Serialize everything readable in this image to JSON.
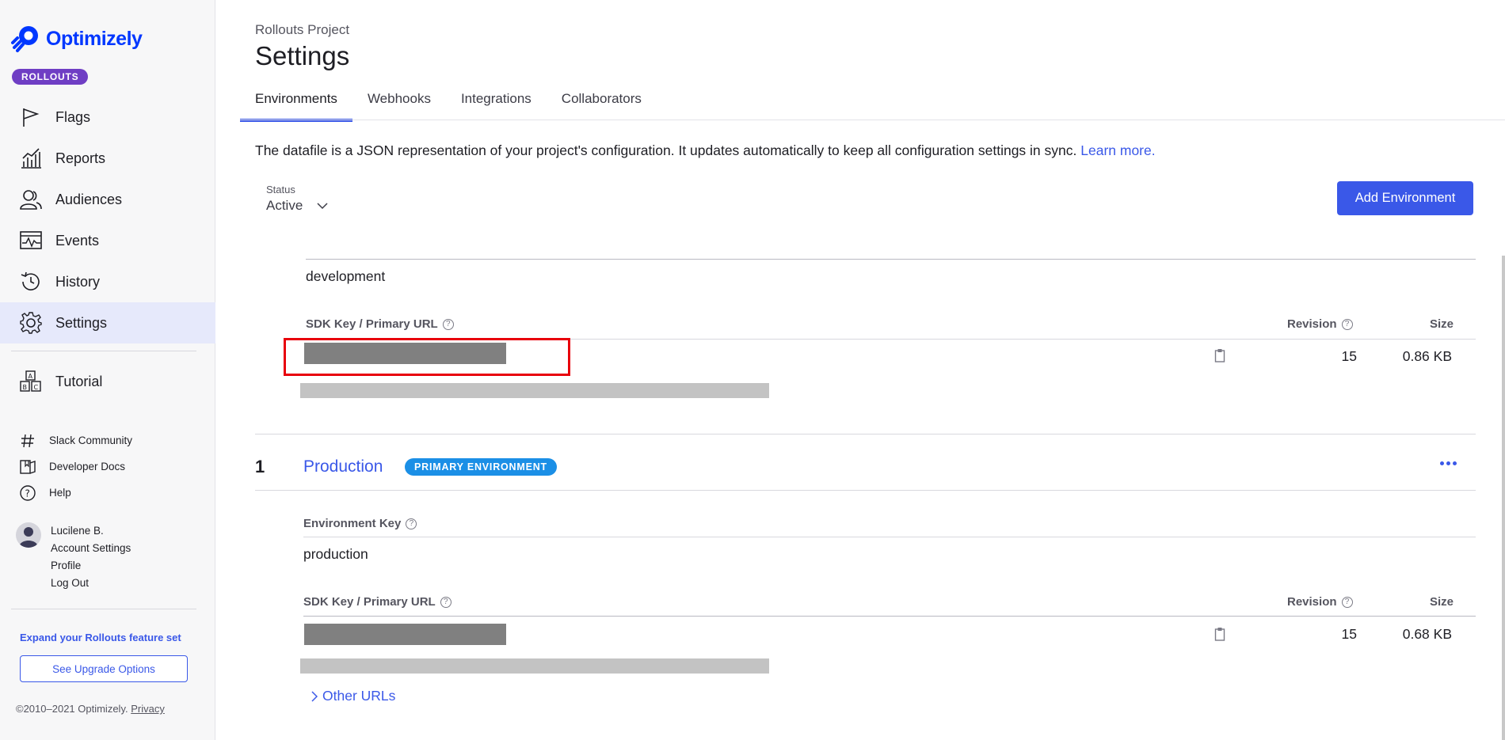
{
  "brand": {
    "name": "Optimizely",
    "product_badge": "ROLLOUTS",
    "color": "#0037ff",
    "badge_color": "#6f3ec4"
  },
  "sidebar": {
    "items": [
      {
        "label": "Flags",
        "icon": "flag-icon"
      },
      {
        "label": "Reports",
        "icon": "bar-chart-icon"
      },
      {
        "label": "Audiences",
        "icon": "users-icon"
      },
      {
        "label": "Events",
        "icon": "pulse-icon"
      },
      {
        "label": "History",
        "icon": "history-icon"
      },
      {
        "label": "Settings",
        "icon": "gear-icon"
      }
    ],
    "tutorial": {
      "label": "Tutorial",
      "icon": "blocks-icon"
    },
    "links": [
      {
        "label": "Slack Community",
        "icon": "hash-icon"
      },
      {
        "label": "Developer Docs",
        "icon": "book-icon"
      },
      {
        "label": "Help",
        "icon": "question-icon"
      }
    ],
    "user": {
      "name": "Lucilene B.",
      "account_settings": "Account Settings",
      "profile": "Profile",
      "logout": "Log Out"
    },
    "expand_text": "Expand your Rollouts feature set",
    "upgrade_button": "See Upgrade Options",
    "copyright": "©2010–2021 Optimizely.",
    "privacy": "Privacy"
  },
  "header": {
    "project": "Rollouts Project",
    "title": "Settings",
    "tabs": [
      "Environments",
      "Webhooks",
      "Integrations",
      "Collaborators"
    ],
    "active_tab": "Environments"
  },
  "description": {
    "text": "The datafile is a JSON representation of your project's configuration. It updates automatically to keep all configuration settings in sync.",
    "link": "Learn more."
  },
  "filter": {
    "label": "Status",
    "value": "Active"
  },
  "add_environment_button": "Add Environment",
  "environments": [
    {
      "key_value": "development",
      "sdk_label": "SDK Key / Primary URL",
      "revision_label": "Revision",
      "size_label": "Size",
      "revision": "15",
      "size": "0.86 KB"
    },
    {
      "number": "1",
      "name": "Production",
      "badge": "PRIMARY ENVIRONMENT",
      "key_label": "Environment Key",
      "key_value": "production",
      "sdk_label": "SDK Key / Primary URL",
      "revision_label": "Revision",
      "size_label": "Size",
      "revision": "15",
      "size": "0.68 KB",
      "other_urls": "Other URLs"
    }
  ]
}
